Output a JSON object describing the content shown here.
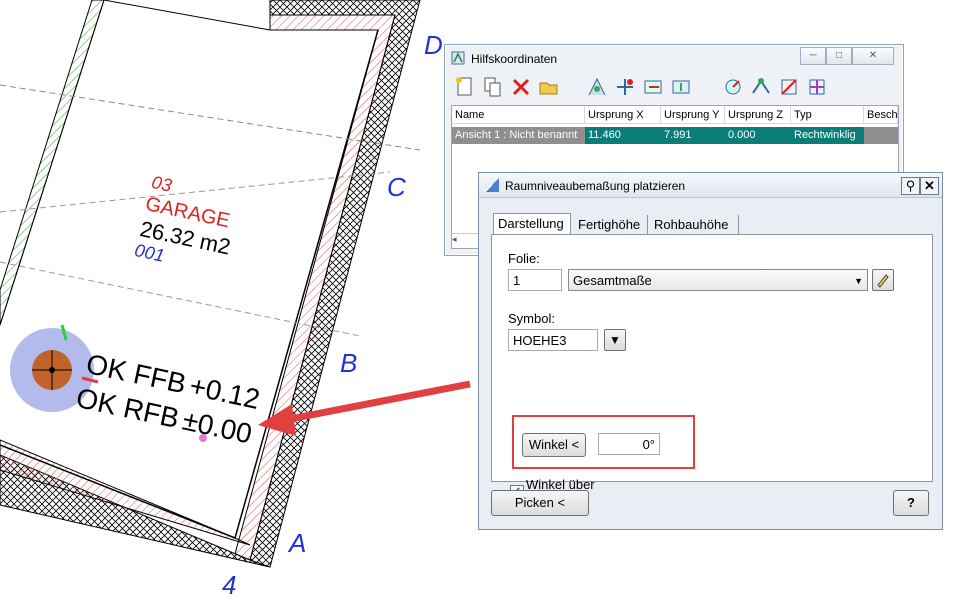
{
  "drawing": {
    "axis_labels": [
      "D",
      "C",
      "B",
      "A",
      "4"
    ],
    "room": {
      "number": "03",
      "name": "GARAGE",
      "area": "26.32 m2",
      "code": "001"
    },
    "level_labels": {
      "ffb_prefix": "OK FFB",
      "ffb_value": "+0.12",
      "rfb_prefix": "OK RFB",
      "rfb_value": "±0.00"
    },
    "colors": {
      "room_text": "#e02020",
      "axis_text": "#1f33d6",
      "arrow": "#e0403f",
      "symbol_fill": "#9aa3e6"
    }
  },
  "hilfskoordinaten": {
    "title": "Hilfskoordinaten",
    "toolbar_icons": [
      "new-icon",
      "copy-icon",
      "delete-icon",
      "open-icon",
      "tool1-icon",
      "tool2-icon",
      "tool3-icon",
      "tool4-icon",
      "tool5-icon",
      "tool6-icon",
      "tool7-icon",
      "tool8-icon"
    ],
    "columns": [
      "Name",
      "Ursprung X",
      "Ursprung Y",
      "Ursprung Z",
      "Typ",
      "Beschr"
    ],
    "rows": [
      {
        "name": "Ansicht 1 : Nicht benannt",
        "x": "11.460",
        "y": "7.991",
        "z": "0.000",
        "typ": "Rechtwinklig"
      }
    ]
  },
  "dialog": {
    "title": "Raumniveaubemaßung platzieren",
    "tabs": [
      "Darstellung",
      "Fertighöhe",
      "Rohbauhöhe"
    ],
    "folie_label": "Folie:",
    "folie_number": "1",
    "folie_select": "Gesamtmaße",
    "symbol_label": "Symbol:",
    "symbol_value": "HOEHE3",
    "winkel_button": "Winkel <",
    "winkel_value": "0°",
    "winkel_checkbox": "Winkel über Element",
    "winkel_checked": true,
    "picken_button": "Picken <",
    "help_button": "?"
  }
}
